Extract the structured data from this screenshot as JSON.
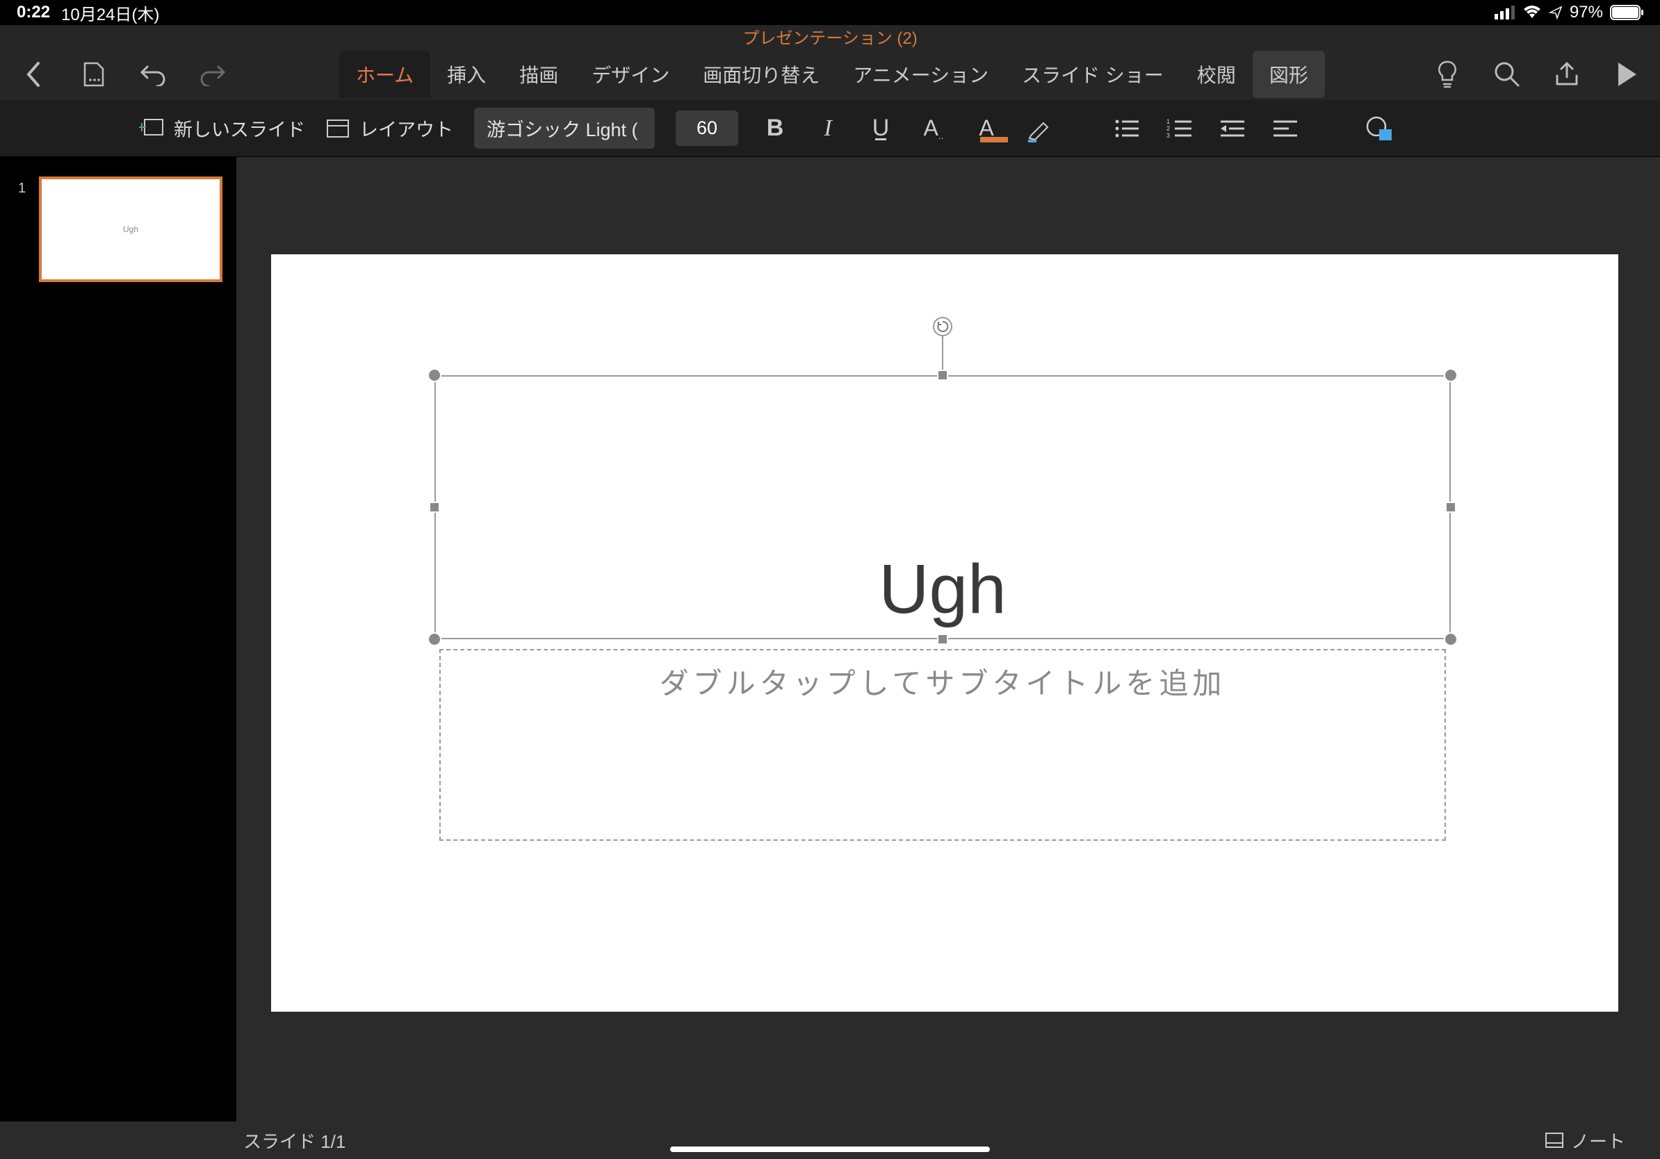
{
  "status": {
    "time": "0:22",
    "date": "10月24日(木)",
    "battery": "97%"
  },
  "document": {
    "title": "プレゼンテーション (2)"
  },
  "tabs": {
    "home": "ホーム",
    "insert": "挿入",
    "draw": "描画",
    "design": "デザイン",
    "transitions": "画面切り替え",
    "animations": "アニメーション",
    "slideshow": "スライド ショー",
    "review": "校閲",
    "shapes": "図形"
  },
  "ribbon": {
    "newSlide": "新しいスライド",
    "layout": "レイアウト",
    "fontName": "游ゴシック Light (",
    "fontSize": "60"
  },
  "thumb": {
    "index": "1",
    "title": "Ugh"
  },
  "slide": {
    "title": "Ugh",
    "subtitlePlaceholder": "ダブルタップしてサブタイトルを追加"
  },
  "footer": {
    "slideCount": "スライド 1/1",
    "notes": "ノート"
  }
}
